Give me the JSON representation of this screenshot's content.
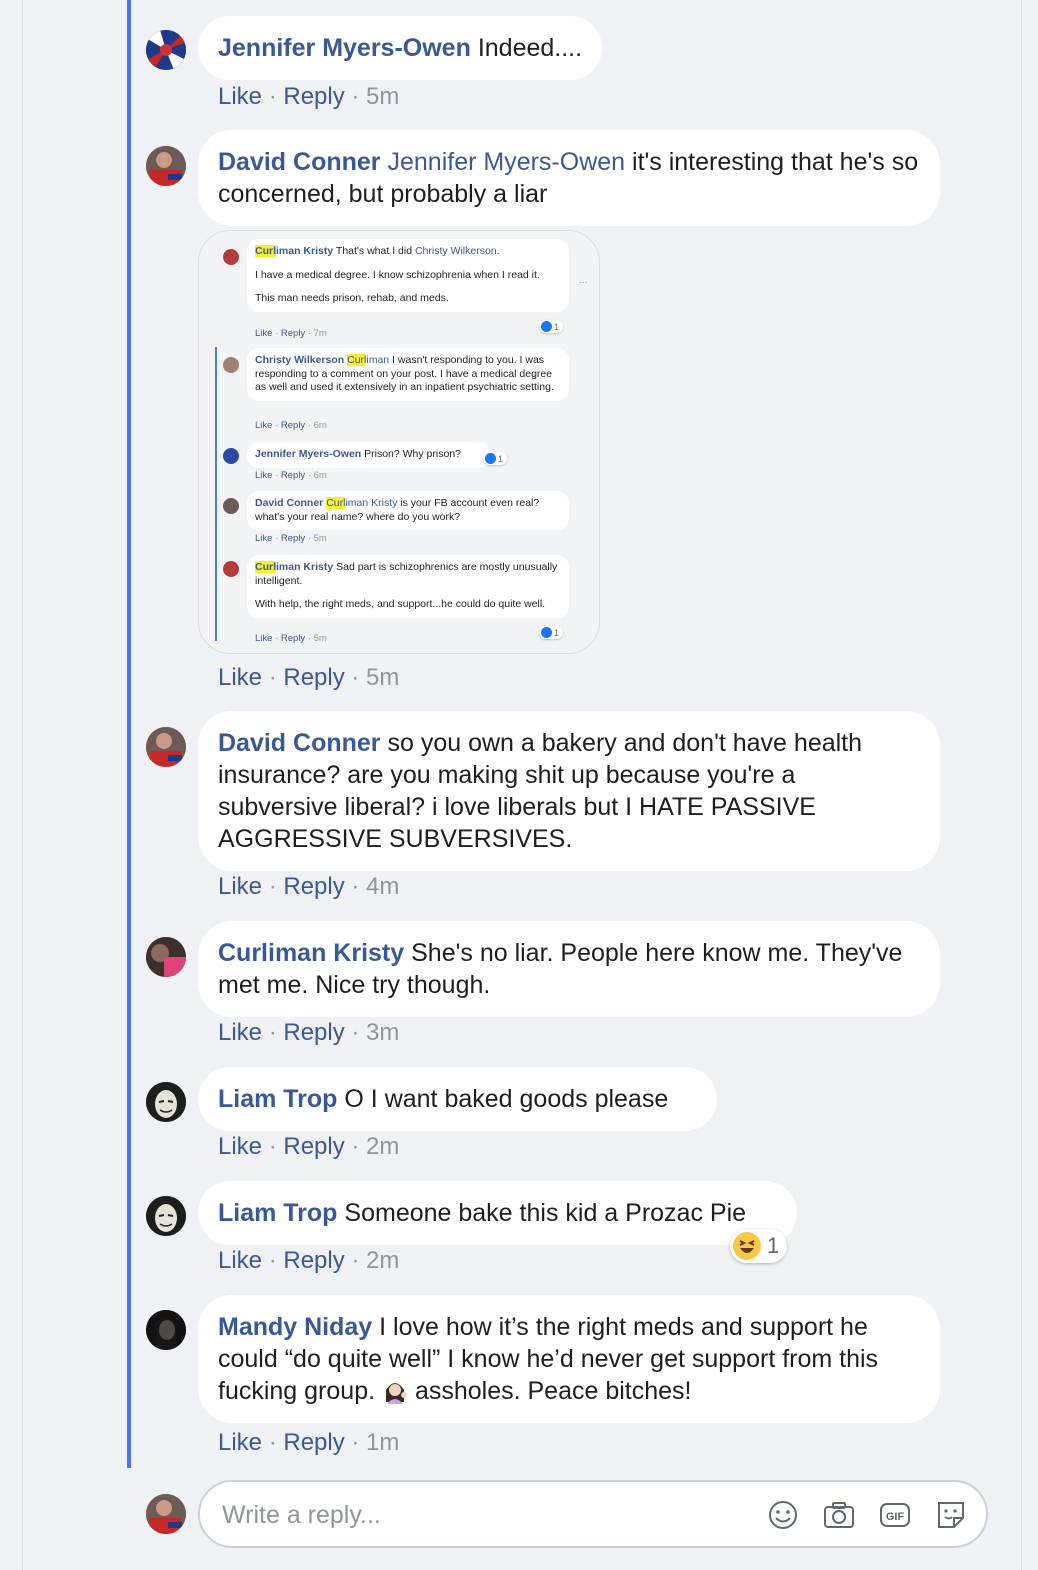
{
  "comments": [
    {
      "name": "Jennifer Myers-Owen",
      "text": "Indeed....",
      "like": "Like",
      "reply": "Reply",
      "time": "5m"
    },
    {
      "name": "David Conner",
      "mention": "Jennifer Myers-Owen",
      "text": " it's interesting that he's so concerned, but probably a liar",
      "like": "Like",
      "reply": "Reply",
      "time": "5m"
    },
    {
      "name": "David Conner",
      "text": " so you own a bakery and don't have health insurance? are you making shit up because you're a subversive liberal? i love liberals but I HATE PASSIVE AGGRESSIVE SUBVERSIVES.",
      "like": "Like",
      "reply": "Reply",
      "time": "4m"
    },
    {
      "name": "Curliman Kristy",
      "text": " She's no liar. People here know me. They've met me. Nice try though.",
      "like": "Like",
      "reply": "Reply",
      "time": "3m"
    },
    {
      "name": "Liam Trop",
      "text": " O I want baked goods please",
      "like": "Like",
      "reply": "Reply",
      "time": "2m"
    },
    {
      "name": "Liam Trop",
      "text": " Someone bake this kid a Prozac Pie",
      "like": "Like",
      "reply": "Reply",
      "time": "2m",
      "reaction": {
        "icon": "haha-emoji-icon",
        "count": "1"
      }
    },
    {
      "name": "Mandy Niday",
      "text": " I love how it’s the right meds and support he could “do quite well” I know he’d never get support from this fucking group.",
      "text2": " assholes. Peace bitches!",
      "emoji": "woman-tipping-hand-emoji-icon",
      "like": "Like",
      "reply": "Reply",
      "time": "1m"
    }
  ],
  "screenshot": {
    "c1": {
      "hl": "Curl",
      "name_rest": "iman Kristy",
      "text": " That's what I did ",
      "mention": "Christy Wilkerson",
      "end": ".",
      "p2": "I have a medical degree. I know schizophrenia when I read it.",
      "p3": "This man needs prison, rehab, and meds.",
      "like": "Like",
      "reply": "Reply",
      "time": "7m",
      "count": "1"
    },
    "c2": {
      "name": "Christy Wilkerson",
      "hl": "Curl",
      "rest": "iman",
      "text": " I wasn't responding to you. I was responding to a comment on your post. I have a medical degree as well and used it extensively in an inpatient psychiatric setting.",
      "like": "Like",
      "reply": "Reply",
      "time": "6m"
    },
    "c3": {
      "name": "Jennifer Myers-Owen",
      "text": " Prison? Why prison?",
      "like": "Like",
      "reply": "Reply",
      "time": "6m",
      "count": "1"
    },
    "c4": {
      "name": "David Conner",
      "hl": "Curl",
      "rest": "iman Kristy",
      "text": " is your FB account even real? what's your real name? where do you work?",
      "like": "Like",
      "reply": "Reply",
      "time": "5m"
    },
    "c5": {
      "hl": "Curl",
      "name_rest": "iman Kristy",
      "text": " Sad part is schizophrenics are mostly unusually intelligent.",
      "p2": "With help, the right meds, and support...he could do quite well.",
      "like": "Like",
      "reply": "Reply",
      "time": "5m",
      "count": "1"
    },
    "more": "..."
  },
  "composer": {
    "placeholder": "Write a reply...",
    "icons": [
      "smiley-icon",
      "camera-icon",
      "gif-icon",
      "sticker-icon"
    ],
    "gif": "GIF"
  },
  "colors": {
    "thread": "#4a76e8",
    "name": "#385898",
    "meta": "#90949c"
  }
}
